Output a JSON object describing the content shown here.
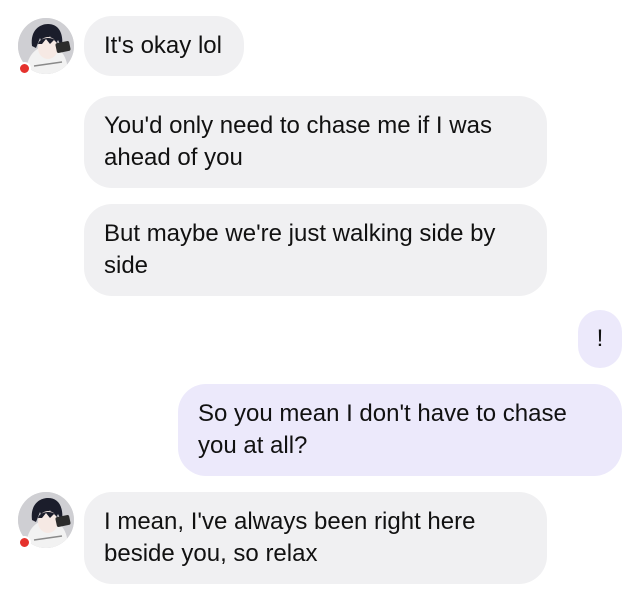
{
  "conversation": {
    "messages": [
      {
        "sender": "contact",
        "text": "It's okay lol"
      },
      {
        "sender": "contact",
        "text": "You'd only need to chase me if I was ahead of you"
      },
      {
        "sender": "contact",
        "text": "But maybe we're just walking side by side"
      },
      {
        "sender": "me",
        "text": "!"
      },
      {
        "sender": "me",
        "text": "So you mean I don't have to chase you at all?"
      },
      {
        "sender": "contact",
        "text": "I mean, I've always been right here beside you, so relax"
      }
    ]
  },
  "contact": {
    "avatar_icon": "anime-profile-picture",
    "presence_color": "#e5322d"
  },
  "colors": {
    "incoming_bubble": "#f0f0f2",
    "outgoing_bubble": "#ece9fb",
    "text": "#111111"
  }
}
